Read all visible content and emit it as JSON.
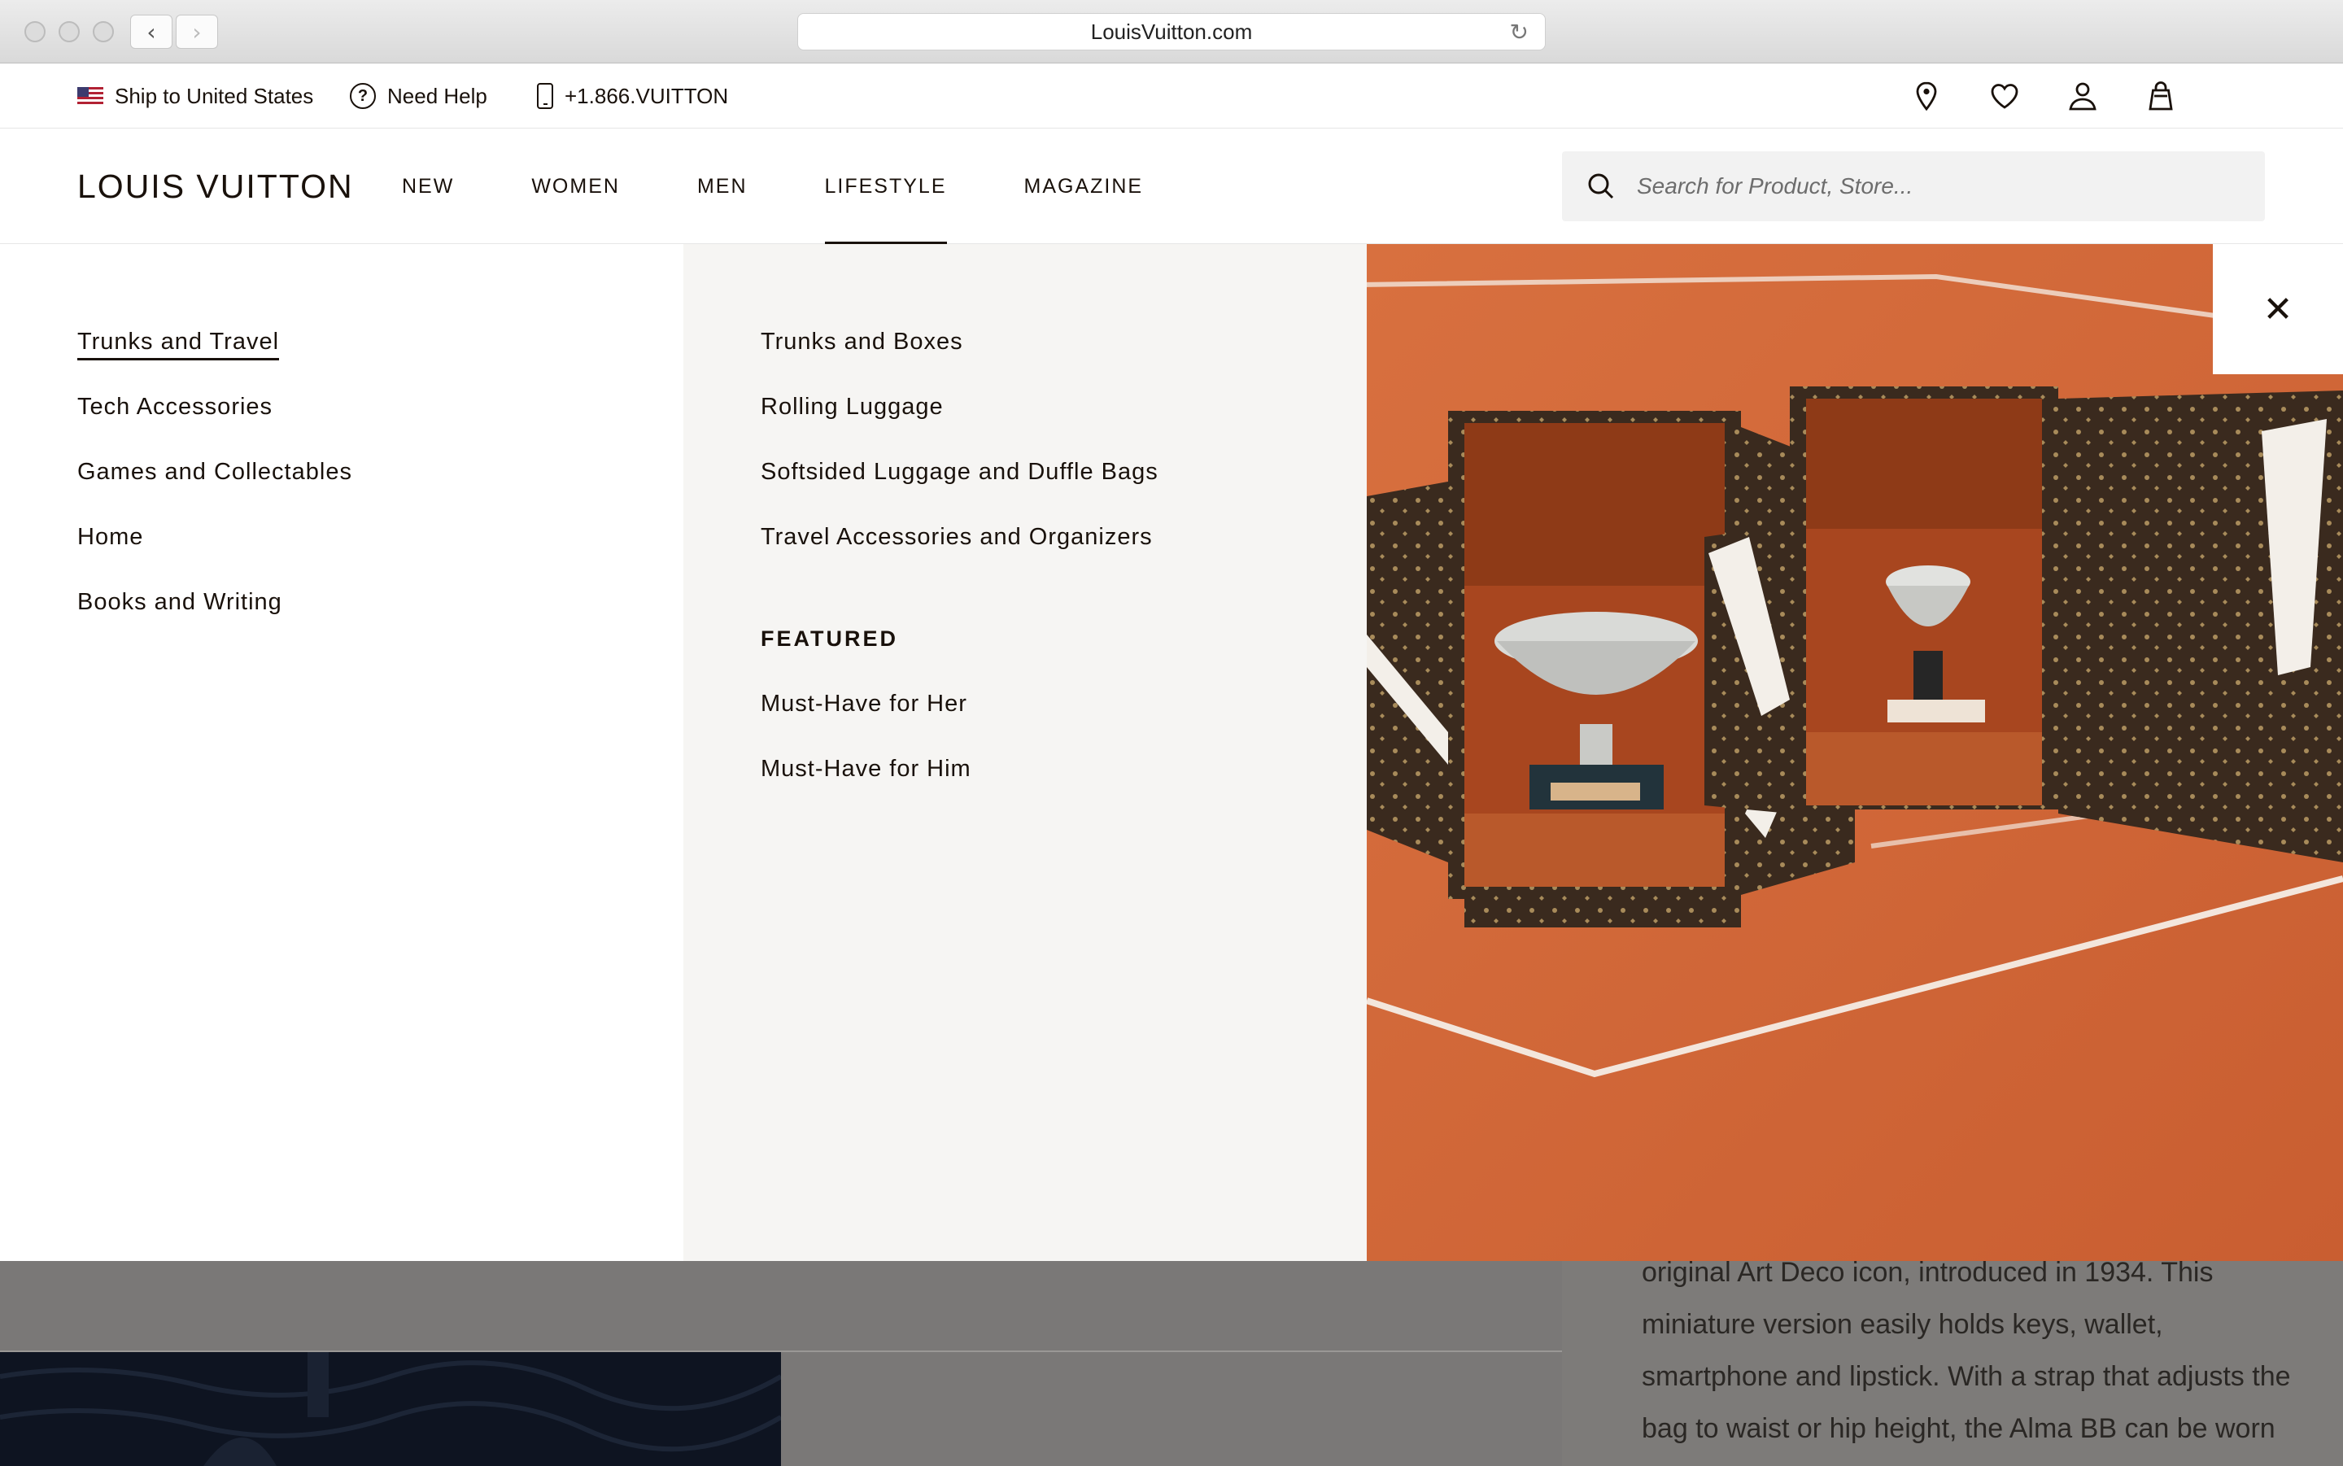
{
  "browser": {
    "url": "LouisVuitton.com",
    "back_glyph": "‹",
    "forward_glyph": "›",
    "reload_glyph": "↻"
  },
  "utility": {
    "ship_to": "Ship to United States",
    "need_help": "Need Help",
    "phone": "+1.866.VUITTON",
    "help_glyph": "?",
    "icons": [
      "location-pin-icon",
      "heart-icon",
      "account-icon",
      "shopping-bag-icon"
    ]
  },
  "header": {
    "logo": "LOUIS VUITTON",
    "nav": [
      "NEW",
      "WOMEN",
      "MEN",
      "LIFESTYLE",
      "MAGAZINE"
    ],
    "active_nav": "LIFESTYLE",
    "search_placeholder": "Search for Product, Store..."
  },
  "menu": {
    "categories": [
      "Trunks and Travel",
      "Tech Accessories",
      "Games and Collectables",
      "Home",
      "Books and Writing"
    ],
    "selected_category": "Trunks and Travel",
    "subcategories": [
      "Trunks and Boxes",
      "Rolling Luggage",
      "Softsided Luggage and Duffle Bags",
      "Travel Accessories and Organizers"
    ],
    "featured_heading": "FEATURED",
    "featured": [
      "Must-Have for Her",
      "Must-Have for Him"
    ],
    "close_glyph": "✕"
  },
  "background_page": {
    "description": "original Art Deco icon, introduced in 1934. This miniature version easily holds keys, wallet, smartphone and lipstick. With a strap that adjusts the bag to waist or hip height, the Alma BB can be worn"
  },
  "colors": {
    "brand_text": "#19110b",
    "menu_mid_bg": "#f6f5f3",
    "clay": "#d5683a"
  }
}
